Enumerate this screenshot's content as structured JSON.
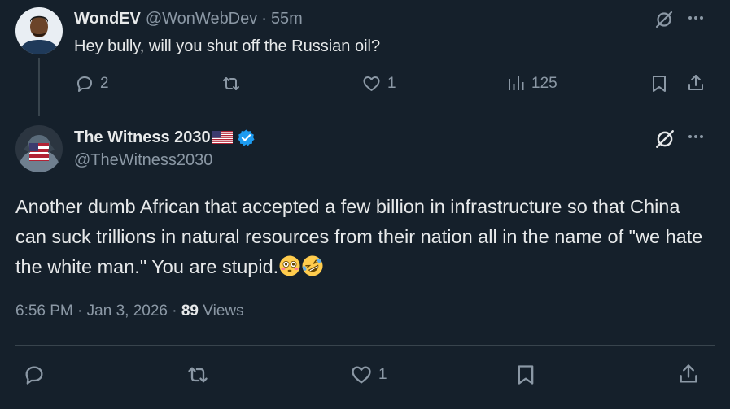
{
  "parent_tweet": {
    "display_name": "WondEV",
    "handle": "@WonWebDev",
    "separator": "·",
    "time": "55m",
    "text": "Hey bully, will you shut off the Russian oil?",
    "replies": "2",
    "reposts": "",
    "likes": "1",
    "views": "125"
  },
  "main_tweet": {
    "display_name": "The Witness 2030",
    "flag_icon": "us-flag-icon",
    "verified_icon": "verified-badge-icon",
    "handle": "@TheWitness2030",
    "text": "Another dumb African that accepted a few billion in infrastructure so that China can suck trillions in natural resources from their nation all in the name of \"we hate the white man.\" You are stupid.",
    "emojis": [
      "flushed-face-emoji",
      "rolling-laughing-emoji"
    ],
    "time": "6:56 PM",
    "date_separator": "·",
    "date": "Jan 3, 2026",
    "views_separator": "·",
    "views_count": "89",
    "views_label": "Views",
    "replies": "",
    "reposts": "",
    "likes": "1"
  },
  "colors": {
    "background": "#15202b",
    "text": "#e7e9ea",
    "muted": "#8b98a5",
    "divider": "#38444d",
    "verified": "#1d9bf0"
  }
}
